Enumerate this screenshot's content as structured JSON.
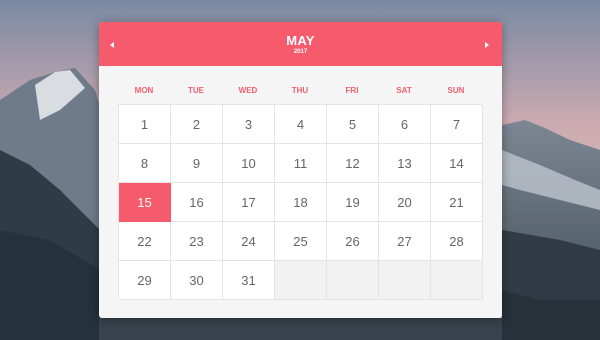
{
  "calendar": {
    "month": "MAY",
    "year": "2017",
    "weekdays": [
      "MON",
      "TUE",
      "WED",
      "THU",
      "FRI",
      "SAT",
      "SUN"
    ],
    "days": [
      "1",
      "2",
      "3",
      "4",
      "5",
      "6",
      "7",
      "8",
      "9",
      "10",
      "11",
      "12",
      "13",
      "14",
      "15",
      "16",
      "17",
      "18",
      "19",
      "20",
      "21",
      "22",
      "23",
      "24",
      "25",
      "26",
      "27",
      "28",
      "29",
      "30",
      "31",
      "",
      "",
      "",
      ""
    ],
    "selected_day": "15"
  },
  "colors": {
    "accent": "#f65a6d",
    "grid_line": "#e4e4e4",
    "day_text": "#666666",
    "panel": "#f5f5f5"
  },
  "icons": {
    "prev": "triangle-left-icon",
    "next": "triangle-right-icon"
  }
}
